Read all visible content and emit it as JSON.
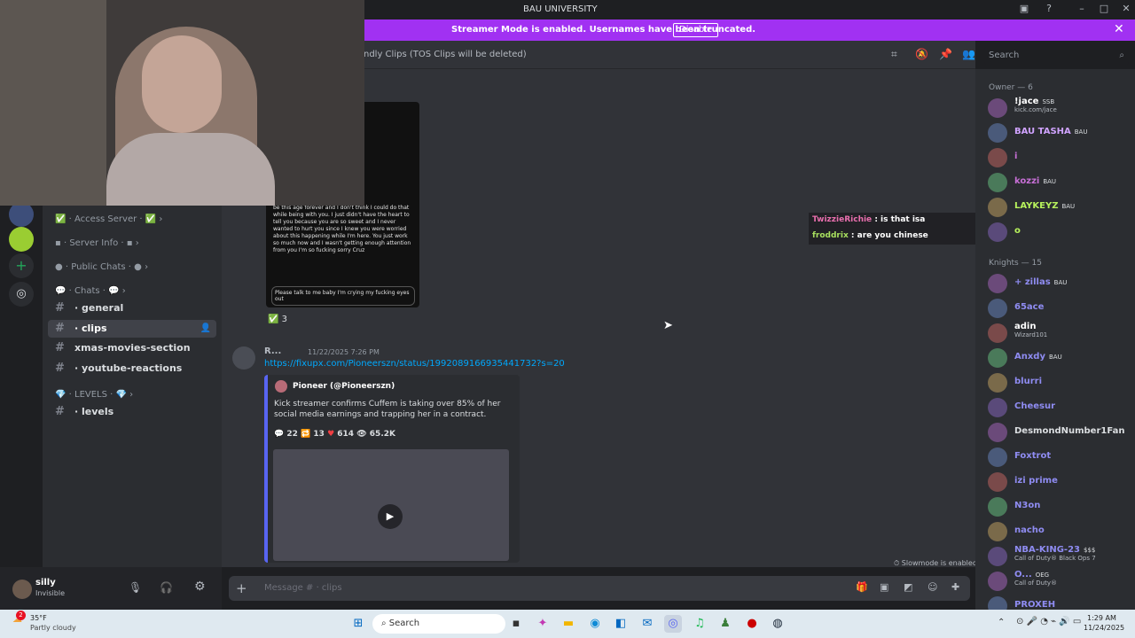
{
  "window": {
    "title": "BAU UNIVERSITY"
  },
  "banner": {
    "message": "Streamer Mode is enabled. Usernames have been truncated.",
    "button": "Disable"
  },
  "channel_header": {
    "topic": "ndly Clips (TOS Clips will be deleted)",
    "search_placeholder": "Search"
  },
  "sidebar": {
    "categories": [
      {
        "label": "Access Server"
      },
      {
        "label": "Server Info"
      },
      {
        "label": "Public Chats"
      },
      {
        "label": "Chats"
      }
    ],
    "channels": [
      {
        "label": "general"
      },
      {
        "label": "clips"
      },
      {
        "label": "xmas-movies-section"
      },
      {
        "label": "youtube-reactions"
      }
    ],
    "levels_category": "LEVELS",
    "levels_channel": "levels"
  },
  "user": {
    "name": "silly",
    "status": "Invisible"
  },
  "messages": {
    "reaction_count": "3",
    "author": "R...",
    "timestamp": "11/22/2025 7:26 PM",
    "link": "https://fixupx.com/Pioneerszn/status/1992089166935441732?s=20",
    "embed_author": "Pioneer (@Pioneerszn)",
    "embed_text": "Kick streamer confirms Cuffem is taking over 85% of her social media earnings and trapping her in a contract.",
    "stats": {
      "replies": "22",
      "retweets": "13",
      "likes": "614",
      "views": "65.2K"
    },
    "phone_text": "be this age forever and I don't think I could do that while being with you. I just didn't have the heart to tell you because you are so sweet and I never wanted to hurt you since I knew you were worried about this happening while I'm here. You just work so much now and I wasn't getting enough attention from you I'm so fucking sorry Cruz",
    "phone_reply": "Please talk to me baby I'm crying my fucking eyes out"
  },
  "overlay_chat": [
    {
      "user": "TwizzieRichie",
      "text": ": is that isa",
      "color": "#e96fae"
    },
    {
      "user": "froddrix",
      "text": ": are you chinese",
      "color": "#a8e05f"
    }
  ],
  "composer": {
    "placeholder": "Message # · clips",
    "slowmode": "Slowmode is enabled."
  },
  "members": {
    "owner_header": "Owner — 6",
    "owners": [
      {
        "name": "!jace",
        "tag": "SSB",
        "sub": "kick.com/jace",
        "color": "#ffffff"
      },
      {
        "name": "BAU TASHA",
        "tag": "BAU",
        "sub": "",
        "color": "#d0a3ff"
      },
      {
        "name": "i",
        "tag": "",
        "sub": "",
        "color": "#c76fd6"
      },
      {
        "name": "kozzi",
        "tag": "BAU",
        "sub": "",
        "color": "#c76fd6"
      },
      {
        "name": "LAYKEYZ",
        "tag": "BAU",
        "sub": "",
        "color": "#b7f25c"
      },
      {
        "name": "o",
        "tag": "",
        "sub": "",
        "color": "#b7f25c"
      }
    ],
    "knights_header": "Knights — 15",
    "knights": [
      {
        "name": "+ zillas",
        "tag": "BAU",
        "sub": "",
        "color": "#8f8cf2"
      },
      {
        "name": "65ace",
        "tag": "",
        "sub": "",
        "color": "#8f8cf2"
      },
      {
        "name": "adin",
        "tag": "",
        "sub": "Wizard101",
        "color": "#ffffff"
      },
      {
        "name": "Anxdy",
        "tag": "BAU",
        "sub": "",
        "color": "#8f8cf2"
      },
      {
        "name": "blurri",
        "tag": "",
        "sub": "",
        "color": "#8f8cf2"
      },
      {
        "name": "Cheesur",
        "tag": "",
        "sub": "",
        "color": "#8f8cf2"
      },
      {
        "name": "DesmondNumber1Fan",
        "tag": "",
        "sub": "",
        "color": "#dbdee1"
      },
      {
        "name": "Foxtrot",
        "tag": "",
        "sub": "",
        "color": "#8f8cf2"
      },
      {
        "name": "izi prime",
        "tag": "",
        "sub": "",
        "color": "#8f8cf2"
      },
      {
        "name": "N3on",
        "tag": "",
        "sub": "",
        "color": "#8f8cf2"
      },
      {
        "name": "nacho",
        "tag": "",
        "sub": "",
        "color": "#8f8cf2"
      },
      {
        "name": "NBA-KING-23",
        "tag": "$$$",
        "sub": "Call of Duty® Black Ops 7",
        "color": "#8f8cf2"
      },
      {
        "name": "O...",
        "tag": "OEG",
        "sub": "Call of Duty®",
        "color": "#8f8cf2"
      },
      {
        "name": "PROXEH",
        "tag": "",
        "sub": "",
        "color": "#8f8cf2"
      }
    ]
  },
  "taskbar": {
    "weather_temp": "35°F",
    "weather_desc": "Partly cloudy",
    "search": "Search",
    "time": "1:29 AM",
    "date": "11/24/2025",
    "notification_count": "2"
  },
  "colors": {
    "accent": "#a131f2",
    "link": "#00a8fc"
  }
}
